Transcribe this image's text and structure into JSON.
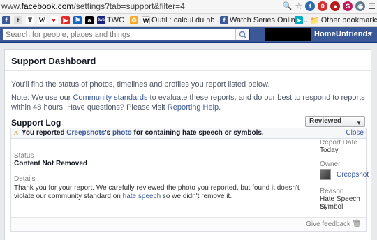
{
  "browser": {
    "url_host": "facebook.com",
    "url_prefix": "www.",
    "url_path": "/settings?tab=support&filter=4",
    "bookmarks": [
      {
        "icon": "fb-icon",
        "label": ""
      },
      {
        "icon": "t-icon",
        "label": ""
      },
      {
        "icon": "nyt-icon",
        "label": ""
      },
      {
        "icon": "wiki-icon",
        "label": ""
      },
      {
        "icon": "heart-icon",
        "label": ""
      },
      {
        "icon": "youtube-icon",
        "label": ""
      },
      {
        "icon": "flag-icon",
        "label": ""
      },
      {
        "icon": "abc-icon",
        "label": ""
      },
      {
        "icon": "twc-icon",
        "label": "TWC"
      },
      {
        "icon": "gear-icon",
        "label": ""
      },
      {
        "icon": "w-icon",
        "label": "Outil : calcul du nb ..."
      },
      {
        "icon": "fb-icon",
        "label": "Watch Series Online ..."
      },
      {
        "icon": "arrow-icon",
        "label": ""
      }
    ],
    "other_bookmarks": "Other bookmarks"
  },
  "header": {
    "search_placeholder": "Search for people, places and things",
    "home": "Home",
    "unfriends": "Unfriends"
  },
  "page": {
    "title": "Support Dashboard",
    "intro": "You'll find the status of photos, timelines and profiles you report listed below.",
    "note_pre": "Note: We use our ",
    "note_link1": "Community standards",
    "note_mid": " to evaluate these reports, and do our best to respond to reports within 48 hours. Have questions? Please visit ",
    "note_link2": "Reporting Help",
    "note_end": ".",
    "log_title": "Support Log",
    "dropdown_label": "Reviewed Reports"
  },
  "report": {
    "msg_pre": "You reported ",
    "owner_link": "Creepshots",
    "msg_mid": "'s ",
    "photo_link": "photo",
    "msg_end": " for containing hate speech or symbols.",
    "close": "Close",
    "status_label": "Status",
    "status_value": "Content Not Removed",
    "details_label": "Details",
    "details_pre": "Thank you for your report. We carefully reviewed the photo you reported, but found it doesn't violate our community standard on ",
    "details_link": "hate speech",
    "details_end": " so we didn't remove it.",
    "date_label": "Report Date",
    "date_value": "Today",
    "owner_label": "Owner",
    "owner_name": "Creepshot",
    "reason_label": "Reason",
    "reason_line1": "Hate Speech or",
    "reason_line2": "Symbol",
    "give_feedback": "Give feedback"
  }
}
